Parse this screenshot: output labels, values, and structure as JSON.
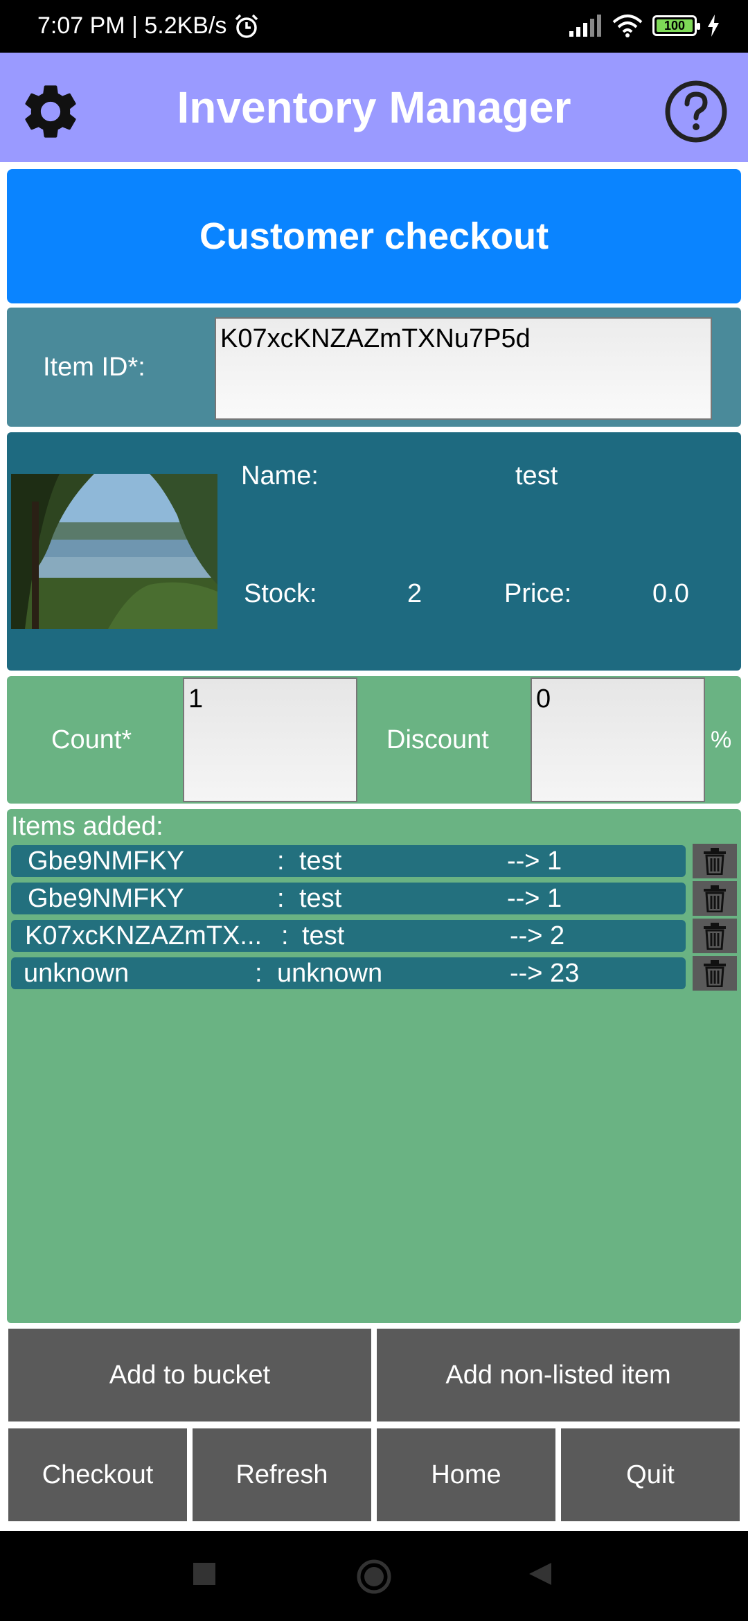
{
  "status_bar": {
    "time_speed": "7:07 PM | 5.2KB/s",
    "battery_level": "100"
  },
  "app_bar": {
    "title": "Inventory Manager"
  },
  "checkout": {
    "banner": "Customer checkout"
  },
  "item_id": {
    "label": "Item ID*:",
    "value": "K07xcKNZAZmTXNu7P5d"
  },
  "item_detail": {
    "name_label": "Name:",
    "name_value": "test",
    "stock_label": "Stock:",
    "stock_value": "2",
    "price_label": "Price:",
    "price_value": "0.0"
  },
  "count_row": {
    "count_label": "Count*",
    "count_value": "1",
    "discount_label": "Discount",
    "discount_value": "0",
    "percent_sign": "%"
  },
  "items": {
    "label": "Items added:",
    "rows": [
      {
        "id": "Gbe9NMFKY",
        "sep": ":",
        "name": "test",
        "qty": "--> 1"
      },
      {
        "id": "Gbe9NMFKY",
        "sep": ":",
        "name": "test",
        "qty": "--> 1"
      },
      {
        "id": "K07xcKNZAZmTX...",
        "sep": ":",
        "name": "test",
        "qty": "--> 2"
      },
      {
        "id": "unknown",
        "sep": ":",
        "name": "unknown",
        "qty": "--> 23"
      }
    ]
  },
  "buttons": {
    "add_to_bucket": "Add to bucket",
    "add_non_listed": "Add non-listed item",
    "checkout": "Checkout",
    "refresh": "Refresh",
    "home": "Home",
    "quit": "Quit"
  },
  "colors": {
    "app_bar": "#9a9aff",
    "banner": "#0a84ff",
    "panel_green": "#6ab383",
    "detail_blue": "#1e6a80",
    "button_gray": "#5a5a5a"
  }
}
